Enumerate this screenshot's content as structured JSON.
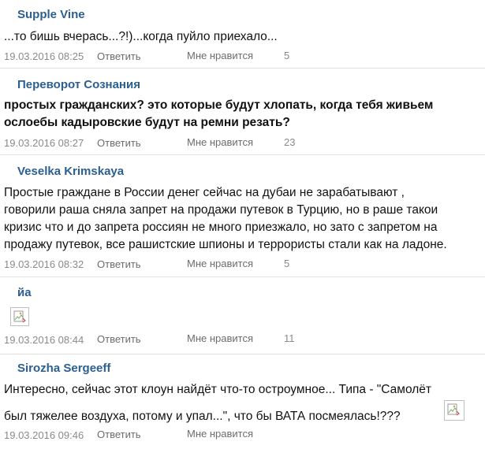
{
  "comments": [
    {
      "author": "Supple Vine",
      "lines": [
        "...то бишь вчерась...?!)...когда пуйло приехало..."
      ],
      "bold": false,
      "date": "19.03.2016 08:25",
      "reply_label": "Ответить",
      "like_label": "Мне нравится",
      "likes": "5"
    },
    {
      "author": "Переворот Сознания",
      "lines": [
        "простых гражданских? это которые будут хлопать, когда тебя живьем",
        "ослоебы кадыровские будут на ремни резать?"
      ],
      "bold": true,
      "date": "19.03.2016 08:27",
      "reply_label": "Ответить",
      "like_label": "Мне нравится",
      "likes": "23"
    },
    {
      "author": "Veselka Krimskaya",
      "lines": [
        "Простые граждане в России денег сейчас на дубаи не зарабатывают ,",
        "говорили раша сняла запрет на продажи путевок в Турцию, но в раше такои",
        "кризис что и до запрета россиян не много приезжало, но зато с запретом на",
        "продажу путевок, все рашистские шпионы и террористы стали как на ладоне."
      ],
      "bold": false,
      "date": "19.03.2016 08:32",
      "reply_label": "Ответить",
      "like_label": "Мне нравится",
      "likes": "5"
    },
    {
      "author": "йа",
      "lines": [],
      "bold": false,
      "has_image": true,
      "image_icon": "broken-image-icon",
      "date": "19.03.2016 08:44",
      "reply_label": "Ответить",
      "like_label": "Мне нравится",
      "likes": "11"
    },
    {
      "author": "Sirozha Sergeeff",
      "lines": [
        "Интересно, сейчас этот клоун найдёт что-то остроумное... Типа - \"Самолёт",
        "был тяжелее воздуха, потому и упал...\", что бы ВАТА посмеялась!???"
      ],
      "bold": false,
      "has_image": true,
      "image_icon": "broken-image-icon",
      "date": "19.03.2016 09:46",
      "reply_label": "Ответить",
      "like_label": "Мне нравится",
      "likes": ""
    }
  ],
  "colors": {
    "author": "#2b5f8f",
    "meta": "#8a8a8a",
    "divider": "#e3e3e3"
  }
}
